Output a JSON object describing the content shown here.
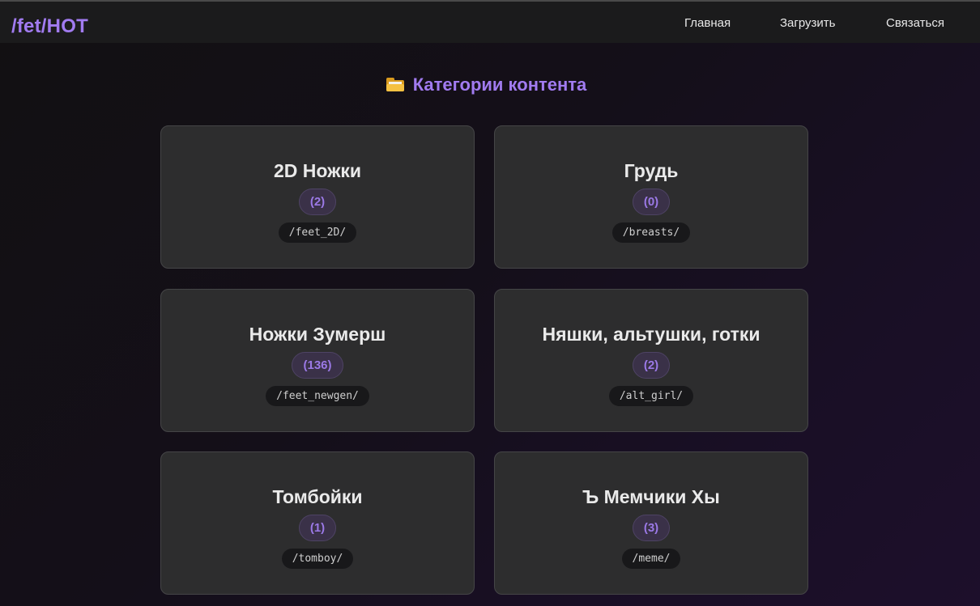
{
  "header": {
    "logo": "/fet/HOT",
    "nav": [
      {
        "label": "Главная"
      },
      {
        "label": "Загрузить"
      },
      {
        "label": "Связаться"
      }
    ]
  },
  "section": {
    "icon": "folder-icon",
    "title": "Категории контента"
  },
  "categories": [
    {
      "title": "2D Ножки",
      "count": "(2)",
      "path": "/feet_2D/"
    },
    {
      "title": "Грудь",
      "count": "(0)",
      "path": "/breasts/"
    },
    {
      "title": "Ножки Зумерш",
      "count": "(136)",
      "path": "/feet_newgen/"
    },
    {
      "title": "Няшки, альтушки, готки",
      "count": "(2)",
      "path": "/alt_girl/"
    },
    {
      "title": "Томбойки",
      "count": "(1)",
      "path": "/tomboy/"
    },
    {
      "title": "Ъ Мемчики Хы",
      "count": "(3)",
      "path": "/meme/"
    }
  ],
  "colors": {
    "accent": "#a17bf0",
    "card_bg": "#2d2d2e",
    "header_bg": "#1b1b1c"
  }
}
